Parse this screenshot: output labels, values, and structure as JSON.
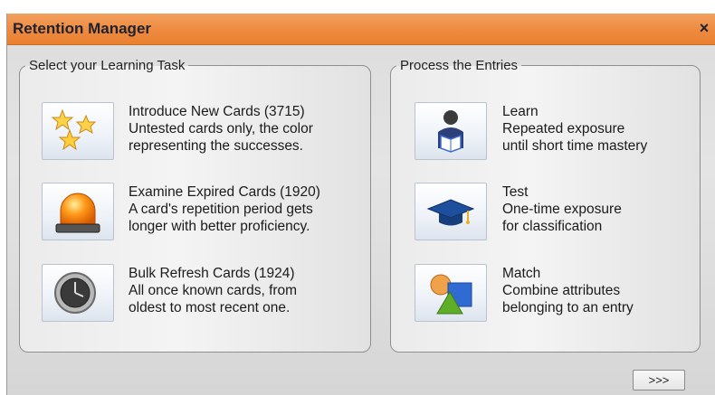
{
  "window": {
    "title": "Retention Manager",
    "close_label": "×"
  },
  "learning_group": {
    "legend": "Select your Learning Task",
    "tasks": [
      {
        "icon": "stars-icon",
        "title": "Introduce New Cards (3715)",
        "line1": "Untested cards only, the color",
        "line2": "representing the successes."
      },
      {
        "icon": "alarm-light-icon",
        "title": "Examine Expired Cards (1920)",
        "line1": "A card's repetition period gets",
        "line2": "longer with better proficiency."
      },
      {
        "icon": "clock-icon",
        "title": "Bulk Refresh Cards (1924)",
        "line1": "All once known cards, from",
        "line2": "oldest to most recent one."
      }
    ]
  },
  "process_group": {
    "legend": "Process the Entries",
    "modes": [
      {
        "icon": "reader-icon",
        "title": "Learn",
        "line1": "Repeated exposure",
        "line2": "until short time mastery"
      },
      {
        "icon": "graduation-cap-icon",
        "title": "Test",
        "line1": "One-time exposure",
        "line2": "for classification"
      },
      {
        "icon": "shapes-icon",
        "title": "Match",
        "line1": "Combine attributes",
        "line2": "belonging to an entry"
      }
    ]
  },
  "footer": {
    "next_label": ">>>"
  }
}
